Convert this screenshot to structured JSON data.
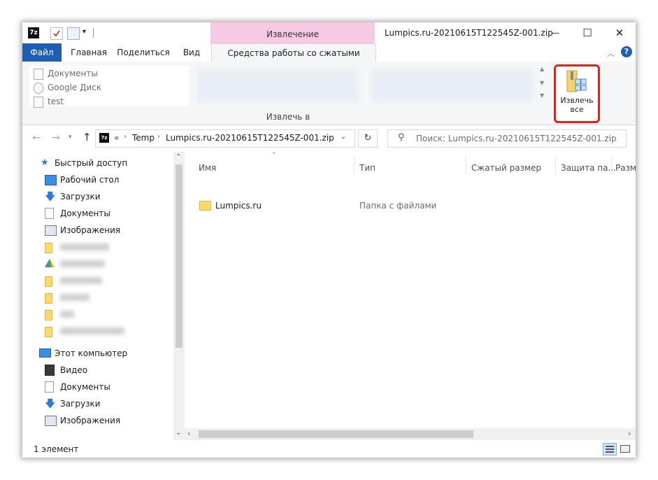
{
  "titlebar": {
    "context_tab": "Извлечение",
    "title": "Lumpics.ru-20210615T122545Z-001.zip",
    "minimize": "—",
    "maximize": "☐",
    "close": "✕"
  },
  "ribbon_tabs": {
    "file": "Файл",
    "home": "Главная",
    "share": "Поделиться",
    "view": "Вид",
    "compressed_tools": "Средства работы со сжатыми папками"
  },
  "ribbon": {
    "destinations": [
      "Документы",
      "Google Диск",
      "test"
    ],
    "group_label": "Извлечь в",
    "extract_all": "Извлечь\nвсе"
  },
  "address": {
    "prefix": "«",
    "crumbs": [
      "Temp",
      "Lumpics.ru-20210615T122545Z-001.zip"
    ],
    "search_placeholder": "Поиск: Lumpics.ru-20210615T122545Z-001.zip"
  },
  "nav": {
    "quick_access": "Быстрый доступ",
    "quick_items": [
      "Рабочий стол",
      "Загрузки",
      "Документы",
      "Изображения"
    ],
    "this_pc": "Этот компьютер",
    "pc_items": [
      "Видео",
      "Документы",
      "Загрузки",
      "Изображения"
    ]
  },
  "columns": [
    "Имя",
    "Тип",
    "Сжатый размер",
    "Защита па...",
    "Разм"
  ],
  "files": [
    {
      "name": "Lumpics.ru",
      "type": "Папка с файлами"
    }
  ],
  "status": {
    "count": "1 элемент"
  },
  "colors": {
    "accent": "#1e5fb4",
    "context_tab": "#f7c9e3",
    "highlight": "#e2231a"
  }
}
